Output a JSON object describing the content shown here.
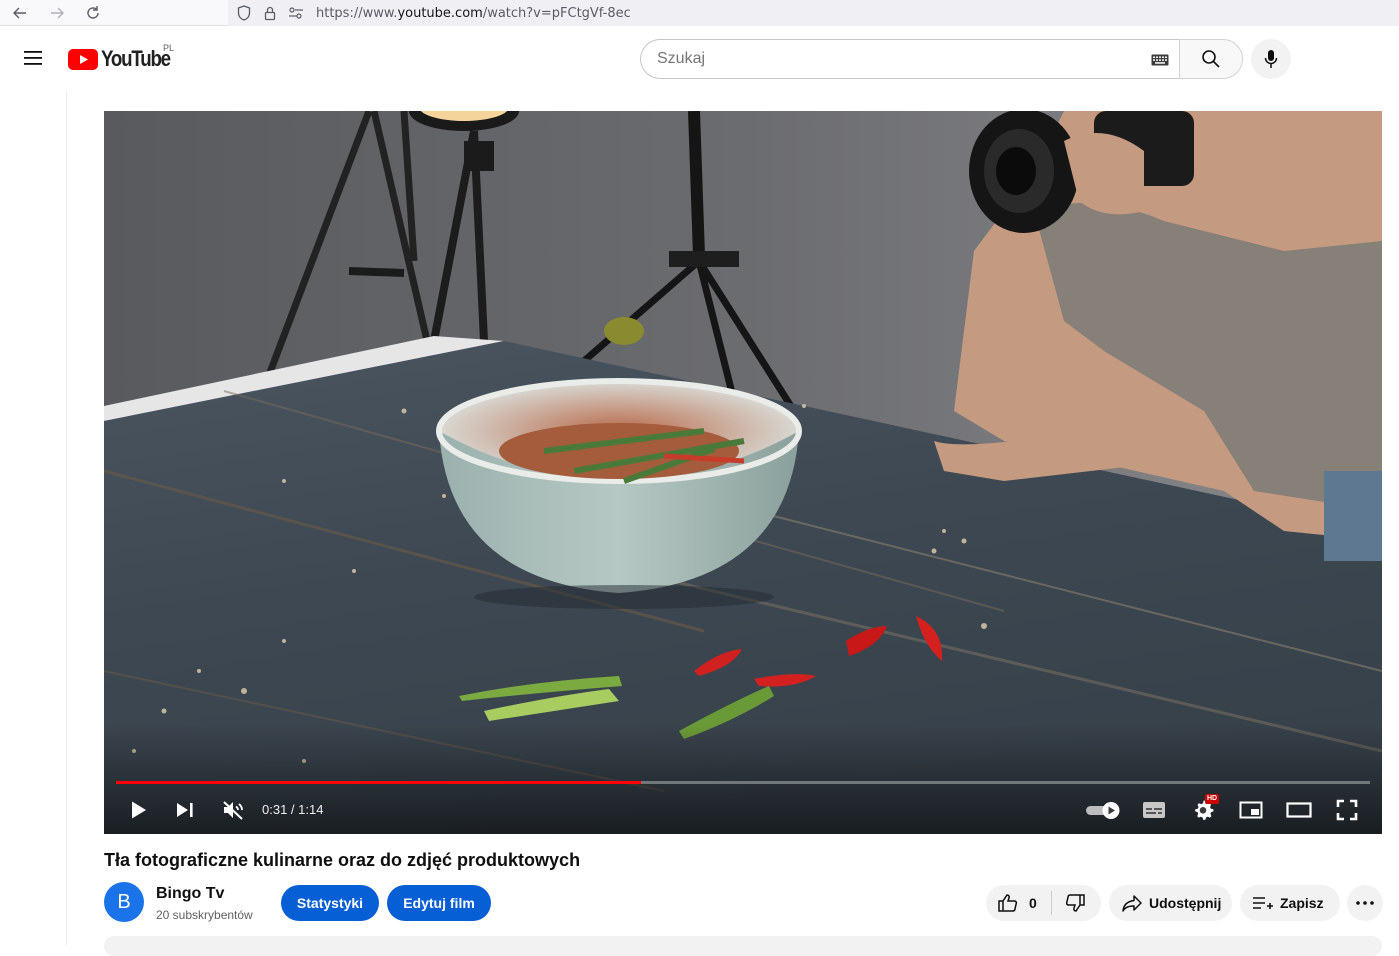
{
  "browser": {
    "url_prefix": "https://www.",
    "url_host": "youtube.com",
    "url_path": "/watch?v=pFCtgVf-8ec"
  },
  "masthead": {
    "logo_text": "YouTube",
    "country_code": "PL",
    "search_placeholder": "Szukaj"
  },
  "player": {
    "time_current": "0:31",
    "time_separator": " / ",
    "time_total": "1:14",
    "progress_fraction": 0.419,
    "hd_badge": "HD",
    "accent_color": "#ff0000"
  },
  "video": {
    "title": "Tła fotograficzne kulinarne oraz do zdjęć produktowych"
  },
  "channel": {
    "avatar_letter": "B",
    "name": "Bingo Tv",
    "subscribers": "20 subskrybentów"
  },
  "actions": {
    "stats_label": "Statystyki",
    "edit_label": "Edytuj film",
    "like_count": "0",
    "share_label": "Udostępnij",
    "save_label": "Zapisz",
    "button_color": "#065fd4"
  }
}
